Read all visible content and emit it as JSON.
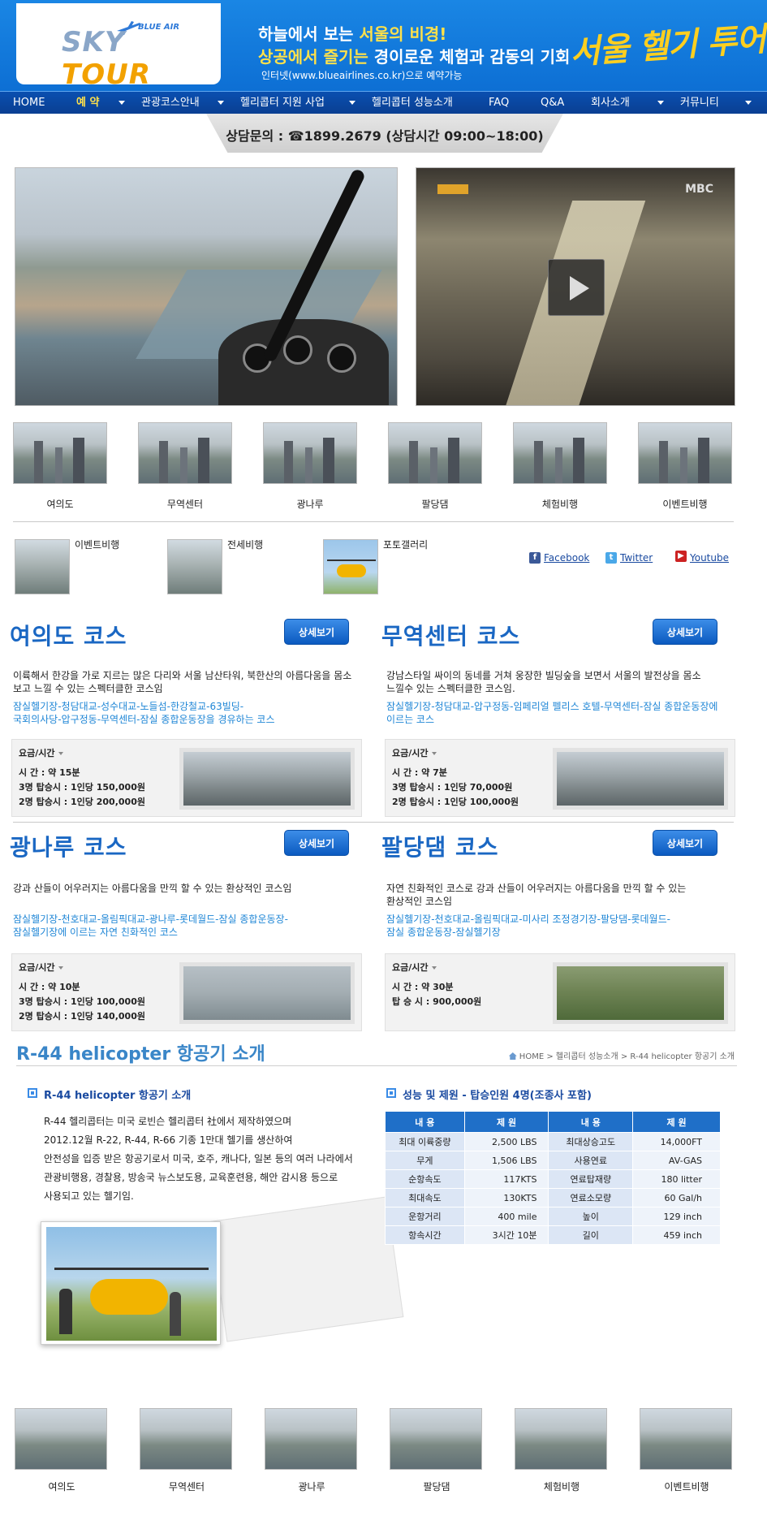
{
  "header": {
    "logo_sky": "SKY",
    "logo_tour": "TOUR",
    "logo_blue_air": "BLUE AIR",
    "tagline1_a": "하늘에서 보는 ",
    "tagline1_b": "서울의 비경!",
    "tagline2_a": "상공에서 즐기는 ",
    "tagline2_b": "경이로운 체험과 감동의 기회",
    "tagline3": "인터넷(www.blueairlines.co.kr)으로 예약가능",
    "brush_title": "서울 헬기 투어"
  },
  "nav": {
    "items": [
      {
        "label": "HOME"
      },
      {
        "label": "예 약"
      },
      {
        "label": "관광코스안내"
      },
      {
        "label": "헬리콥터 지원 사업"
      },
      {
        "label": "헬리콥터 성능소개"
      },
      {
        "label": "FAQ"
      },
      {
        "label": "Q&A"
      },
      {
        "label": "회사소개"
      },
      {
        "label": "커뮤니티"
      }
    ]
  },
  "contact": "상담문의 : ☎1899.2679 (상담시간 09:00~18:00)",
  "video": {
    "watermark": "MBC"
  },
  "thumbs": [
    {
      "label": "여의도"
    },
    {
      "label": "무역센터"
    },
    {
      "label": "광나루"
    },
    {
      "label": "팔당댐"
    },
    {
      "label": "체험비행"
    },
    {
      "label": "이벤트비행"
    }
  ],
  "small_thumbs": [
    {
      "label": "이벤트비행"
    },
    {
      "label": "전세비행"
    },
    {
      "label": "포토갤러리"
    }
  ],
  "social": [
    {
      "label": "Facebook",
      "icon": "facebook-icon",
      "color": "#3b5998"
    },
    {
      "label": "Twitter",
      "icon": "twitter-icon",
      "color": "#4aa8e8"
    },
    {
      "label": "Youtube",
      "icon": "youtube-icon",
      "color": "#cc2222"
    }
  ],
  "courses": [
    {
      "title": "여의도 코스",
      "button": "상세보기",
      "desc1": "이륙해서 한강을 가로 지르는 많은 다리와 서울 남산타워, 북한산의 아름다움을 몸소",
      "desc2": "보고 느낄 수 있는 스펙터클한 코스임",
      "route1": "잠실헬기장-청담대교-성수대교-노들섬-한강철교-63빌딩-",
      "route2": "국회의사당-압구정동-무역센터-잠실 종합운동장을 경유하는 코스",
      "price_head": "요금/시간",
      "price1": "시       간 : 약 15분",
      "price2": "3명 탑승시 : 1인당 150,000원",
      "price3": "2명 탑승시 : 1인당 200,000원"
    },
    {
      "title": "무역센터 코스",
      "button": "상세보기",
      "desc1": "강남스타일 싸이의 동네를 거쳐 웅장한 빌딩숲을 보면서 서울의 발전상을 몸소",
      "desc2": "느낄수 있는 스펙터클한 코스임.",
      "route1": "잠실헬기장-청담대교-압구정동-임페리얼 펠리스 호텔-무역센터-잠실 종합운동장에",
      "route2": "이르는 코스",
      "price_head": "요금/시간",
      "price1": "시       간 : 약 7분",
      "price2": "3명 탑승시 : 1인당 70,000원",
      "price3": "2명 탑승시 : 1인당 100,000원"
    },
    {
      "title": "광나루 코스",
      "button": "상세보기",
      "desc1": "강과 산들이 어우러지는 아름다움을 만끽 할 수 있는 환상적인 코스임",
      "desc2": "",
      "route1": "잠실헬기장-천호대교-올림픽대교-광나루-롯데월드-잠실 종합운동장-",
      "route2": "잠실헬기장에 이르는 자연 친화적인 코스",
      "price_head": "요금/시간",
      "price1": "시       간 : 약 10분",
      "price2": "3명 탑승시 : 1인당 100,000원",
      "price3": "2명 탑승시 : 1인당 140,000원"
    },
    {
      "title": "팔당댐 코스",
      "button": "상세보기",
      "desc1": "자연 친화적인 코스로 강과 산들이 어우러지는 아름다움을 만끽 할 수 있는",
      "desc2": "환상적인 코스임",
      "route1": "잠실헬기장-천호대교-올림픽대교-미사리 조정경기장-팔당댐-롯데월드-",
      "route2": "잠실 종합운동장-잠실헬기장",
      "price_head": "요금/시간",
      "price1": "시       간 : 약 30분",
      "price2": "탑    승    시 : 900,000원",
      "price3": ""
    }
  ],
  "r44": {
    "title": "R-44 helicopter 항공기 소개",
    "breadcrumb": "HOME > 헬리콥터 성능소개 > R-44 helicopter 항공기 소개",
    "intro_head": "R-44 helicopter 항공기 소개",
    "intro": [
      "R-44 헬리콥터는 미국 로빈슨 헬리콥터 社에서 제작하였으며",
      "2012.12월 R-22, R-44, R-66 기종 1만대 헬기를 생산하여",
      "안전성을 입증 받은 항공기로서 미국, 호주, 캐나다, 일본 등의 여러 나라에서",
      "관광비행용, 경찰용, 방송국 뉴스보도용, 교육훈련용, 해안 감시용 등으로",
      "사용되고 있는 헬기임."
    ],
    "spec_head": "성능 및 제원 - 탑승인원 4명(조종사 포함)",
    "spec_cols": [
      "내 용",
      "제 원",
      "내 용",
      "제 원"
    ],
    "spec_rows": [
      [
        "최대 이륙중량",
        "2,500 LBS",
        "최대상승고도",
        "14,000FT"
      ],
      [
        "무게",
        "1,506 LBS",
        "사용연료",
        "AV-GAS"
      ],
      [
        "순항속도",
        "117KTS",
        "연료탑재량",
        "180 litter"
      ],
      [
        "최대속도",
        "130KTS",
        "연료소모량",
        "60 Gal/h"
      ],
      [
        "운항거리",
        "400 mile",
        "높이",
        "129 inch"
      ],
      [
        "항속시간",
        "3시간 10분",
        "길이",
        "459 inch"
      ]
    ]
  },
  "bottom_thumbs": [
    {
      "label": "여의도"
    },
    {
      "label": "무역센터"
    },
    {
      "label": "광나루"
    },
    {
      "label": "팔당댐"
    },
    {
      "label": "체험비행"
    },
    {
      "label": "이벤트비행"
    }
  ]
}
